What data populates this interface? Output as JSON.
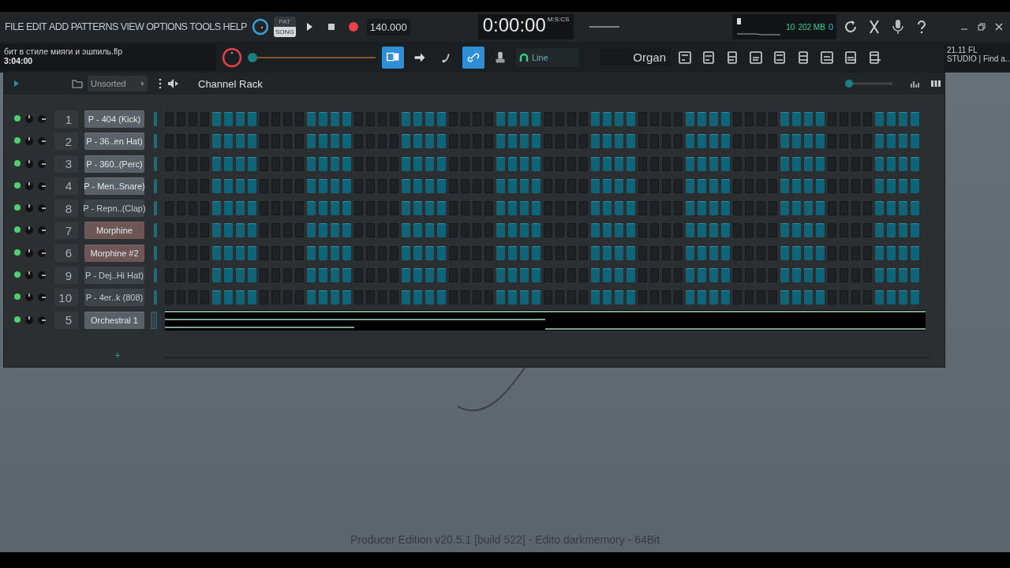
{
  "menu": [
    "FILE",
    "EDIT",
    "ADD",
    "PATTERNS",
    "VIEW",
    "OPTIONS",
    "TOOLS",
    "HELP"
  ],
  "mode_toggle": [
    {
      "label": "PAT",
      "selected": false
    },
    {
      "label": "SONG",
      "selected": true
    }
  ],
  "tempo": "140.000",
  "time_display": {
    "value": "0:00:00",
    "unit": "M:S:CS"
  },
  "project": {
    "file": "бит в стиле мияги и эшпиль.flp",
    "length": "3:04:00"
  },
  "meters": {
    "polyphony": "10",
    "memory": "202 MB",
    "cpu": "0"
  },
  "master_slider": {
    "level": 0
  },
  "toolbar_buttons": [
    {
      "on": true
    },
    {
      "on": false
    },
    {
      "on": false
    },
    {
      "on": true
    },
    {
      "on": false
    }
  ],
  "snap": "Line",
  "preset": "Organ",
  "hint": [
    "21.11  FL",
    "STUDIO | Find a.."
  ],
  "channel_rack": {
    "title": "Channel Rack",
    "filter": "Unsorted",
    "swing_slider": {
      "level": 0
    },
    "channels": [
      {
        "number": "1",
        "name": "P - 404 (Kick)",
        "enabled": true,
        "selected": true,
        "color": "#5a6168",
        "kind": "steps",
        "steps": [
          false,
          false,
          false,
          false,
          true,
          true,
          true,
          true,
          false,
          false,
          false,
          false,
          true,
          true,
          true,
          true,
          false,
          false,
          false,
          false,
          true,
          true,
          true,
          true,
          false,
          false,
          false,
          false,
          true,
          true,
          true,
          true,
          false,
          false,
          false,
          false,
          true,
          true,
          true,
          true,
          false,
          false,
          false,
          false,
          true,
          true,
          true,
          true,
          false,
          false,
          false,
          false,
          true,
          true,
          true,
          true,
          false,
          false,
          false,
          false,
          true,
          true,
          true,
          true
        ]
      },
      {
        "number": "2",
        "name": "P - 36..en Hat)",
        "enabled": true,
        "selected": true,
        "color": "#5a6168",
        "kind": "steps",
        "steps": [
          false,
          false,
          false,
          false,
          true,
          true,
          true,
          true,
          false,
          false,
          false,
          false,
          true,
          true,
          true,
          true,
          false,
          false,
          false,
          false,
          true,
          true,
          true,
          true,
          false,
          false,
          false,
          false,
          true,
          true,
          true,
          true,
          false,
          false,
          false,
          false,
          true,
          true,
          true,
          true,
          false,
          false,
          false,
          false,
          true,
          true,
          true,
          true,
          false,
          false,
          false,
          false,
          true,
          true,
          true,
          true,
          false,
          false,
          false,
          false,
          true,
          true,
          true,
          true
        ]
      },
      {
        "number": "3",
        "name": "P - 360..(Perc)",
        "enabled": true,
        "selected": true,
        "color": "#5a6168",
        "kind": "steps",
        "steps": [
          false,
          false,
          false,
          false,
          true,
          true,
          true,
          true,
          false,
          false,
          false,
          false,
          true,
          true,
          true,
          true,
          false,
          false,
          false,
          false,
          true,
          true,
          true,
          true,
          false,
          false,
          false,
          false,
          true,
          true,
          true,
          true,
          false,
          false,
          false,
          false,
          true,
          true,
          true,
          true,
          false,
          false,
          false,
          false,
          true,
          true,
          true,
          true,
          false,
          false,
          false,
          false,
          true,
          true,
          true,
          true,
          false,
          false,
          false,
          false,
          true,
          true,
          true,
          true
        ]
      },
      {
        "number": "4",
        "name": "P - Men..Snare)",
        "enabled": true,
        "selected": true,
        "color": "#5a6168",
        "kind": "steps",
        "steps": [
          false,
          false,
          false,
          false,
          true,
          true,
          true,
          true,
          false,
          false,
          false,
          false,
          true,
          true,
          true,
          true,
          false,
          false,
          false,
          false,
          true,
          true,
          true,
          true,
          false,
          false,
          false,
          false,
          true,
          true,
          true,
          true,
          false,
          false,
          false,
          false,
          true,
          true,
          true,
          true,
          false,
          false,
          false,
          false,
          true,
          true,
          true,
          true,
          false,
          false,
          false,
          false,
          true,
          true,
          true,
          true,
          false,
          false,
          false,
          false,
          true,
          true,
          true,
          true
        ]
      },
      {
        "number": "8",
        "name": "P - Repn..(Clap)",
        "enabled": true,
        "selected": false,
        "color": "#3e4347",
        "kind": "steps",
        "steps": [
          false,
          false,
          false,
          false,
          true,
          true,
          true,
          true,
          false,
          false,
          false,
          false,
          true,
          true,
          true,
          true,
          false,
          false,
          false,
          false,
          true,
          true,
          true,
          true,
          false,
          false,
          false,
          false,
          true,
          true,
          true,
          true,
          false,
          false,
          false,
          false,
          true,
          true,
          true,
          true,
          false,
          false,
          false,
          false,
          true,
          true,
          true,
          true,
          false,
          false,
          false,
          false,
          true,
          true,
          true,
          true,
          false,
          false,
          false,
          false,
          true,
          true,
          true,
          true
        ]
      },
      {
        "number": "7",
        "name": "Morphine",
        "enabled": true,
        "selected": true,
        "color": "#6e5556",
        "kind": "steps",
        "steps": [
          false,
          false,
          false,
          false,
          true,
          true,
          true,
          true,
          false,
          false,
          false,
          false,
          true,
          true,
          true,
          true,
          false,
          false,
          false,
          false,
          true,
          true,
          true,
          true,
          false,
          false,
          false,
          false,
          true,
          true,
          true,
          true,
          false,
          false,
          false,
          false,
          true,
          true,
          true,
          true,
          false,
          false,
          false,
          false,
          true,
          true,
          true,
          true,
          false,
          false,
          false,
          false,
          true,
          true,
          true,
          true,
          false,
          false,
          false,
          false,
          true,
          true,
          true,
          true
        ]
      },
      {
        "number": "6",
        "name": "Morphine #2",
        "enabled": true,
        "selected": true,
        "color": "#6e5556",
        "kind": "steps",
        "steps": [
          false,
          false,
          false,
          false,
          true,
          true,
          true,
          true,
          false,
          false,
          false,
          false,
          true,
          true,
          true,
          true,
          false,
          false,
          false,
          false,
          true,
          true,
          true,
          true,
          false,
          false,
          false,
          false,
          true,
          true,
          true,
          true,
          false,
          false,
          false,
          false,
          true,
          true,
          true,
          true,
          false,
          false,
          false,
          false,
          true,
          true,
          true,
          true,
          false,
          false,
          false,
          false,
          true,
          true,
          true,
          true,
          false,
          false,
          false,
          false,
          true,
          true,
          true,
          true
        ]
      },
      {
        "number": "9",
        "name": "P - Dej..Hi Hat)",
        "enabled": true,
        "selected": false,
        "color": "#3e4347",
        "kind": "steps",
        "steps": [
          false,
          false,
          false,
          false,
          true,
          true,
          true,
          true,
          false,
          false,
          false,
          false,
          true,
          true,
          true,
          true,
          false,
          false,
          false,
          false,
          true,
          true,
          true,
          true,
          false,
          false,
          false,
          false,
          true,
          true,
          true,
          true,
          false,
          false,
          false,
          false,
          true,
          true,
          true,
          true,
          false,
          false,
          false,
          false,
          true,
          true,
          true,
          true,
          false,
          false,
          false,
          false,
          true,
          true,
          true,
          true,
          false,
          false,
          false,
          false,
          true,
          true,
          true,
          true
        ]
      },
      {
        "number": "10",
        "name": "P - 4er..k (808)",
        "enabled": true,
        "selected": false,
        "color": "#3e4347",
        "kind": "steps",
        "steps": [
          false,
          false,
          false,
          false,
          true,
          true,
          true,
          true,
          false,
          false,
          false,
          false,
          true,
          true,
          true,
          true,
          false,
          false,
          false,
          false,
          true,
          true,
          true,
          true,
          false,
          false,
          false,
          false,
          true,
          true,
          true,
          true,
          false,
          false,
          false,
          false,
          true,
          true,
          true,
          true,
          false,
          false,
          false,
          false,
          true,
          true,
          true,
          true,
          false,
          false,
          false,
          false,
          true,
          true,
          true,
          true,
          false,
          false,
          false,
          false,
          true,
          true,
          true,
          true
        ]
      },
      {
        "number": "5",
        "name": "Orchestral 1",
        "enabled": true,
        "selected": true,
        "color": "#5a6168",
        "kind": "pianoroll"
      }
    ],
    "add_button": "+"
  },
  "status": "Producer Edition v20.5.1 [build 522] - Edito darkmemory - 64Bit"
}
